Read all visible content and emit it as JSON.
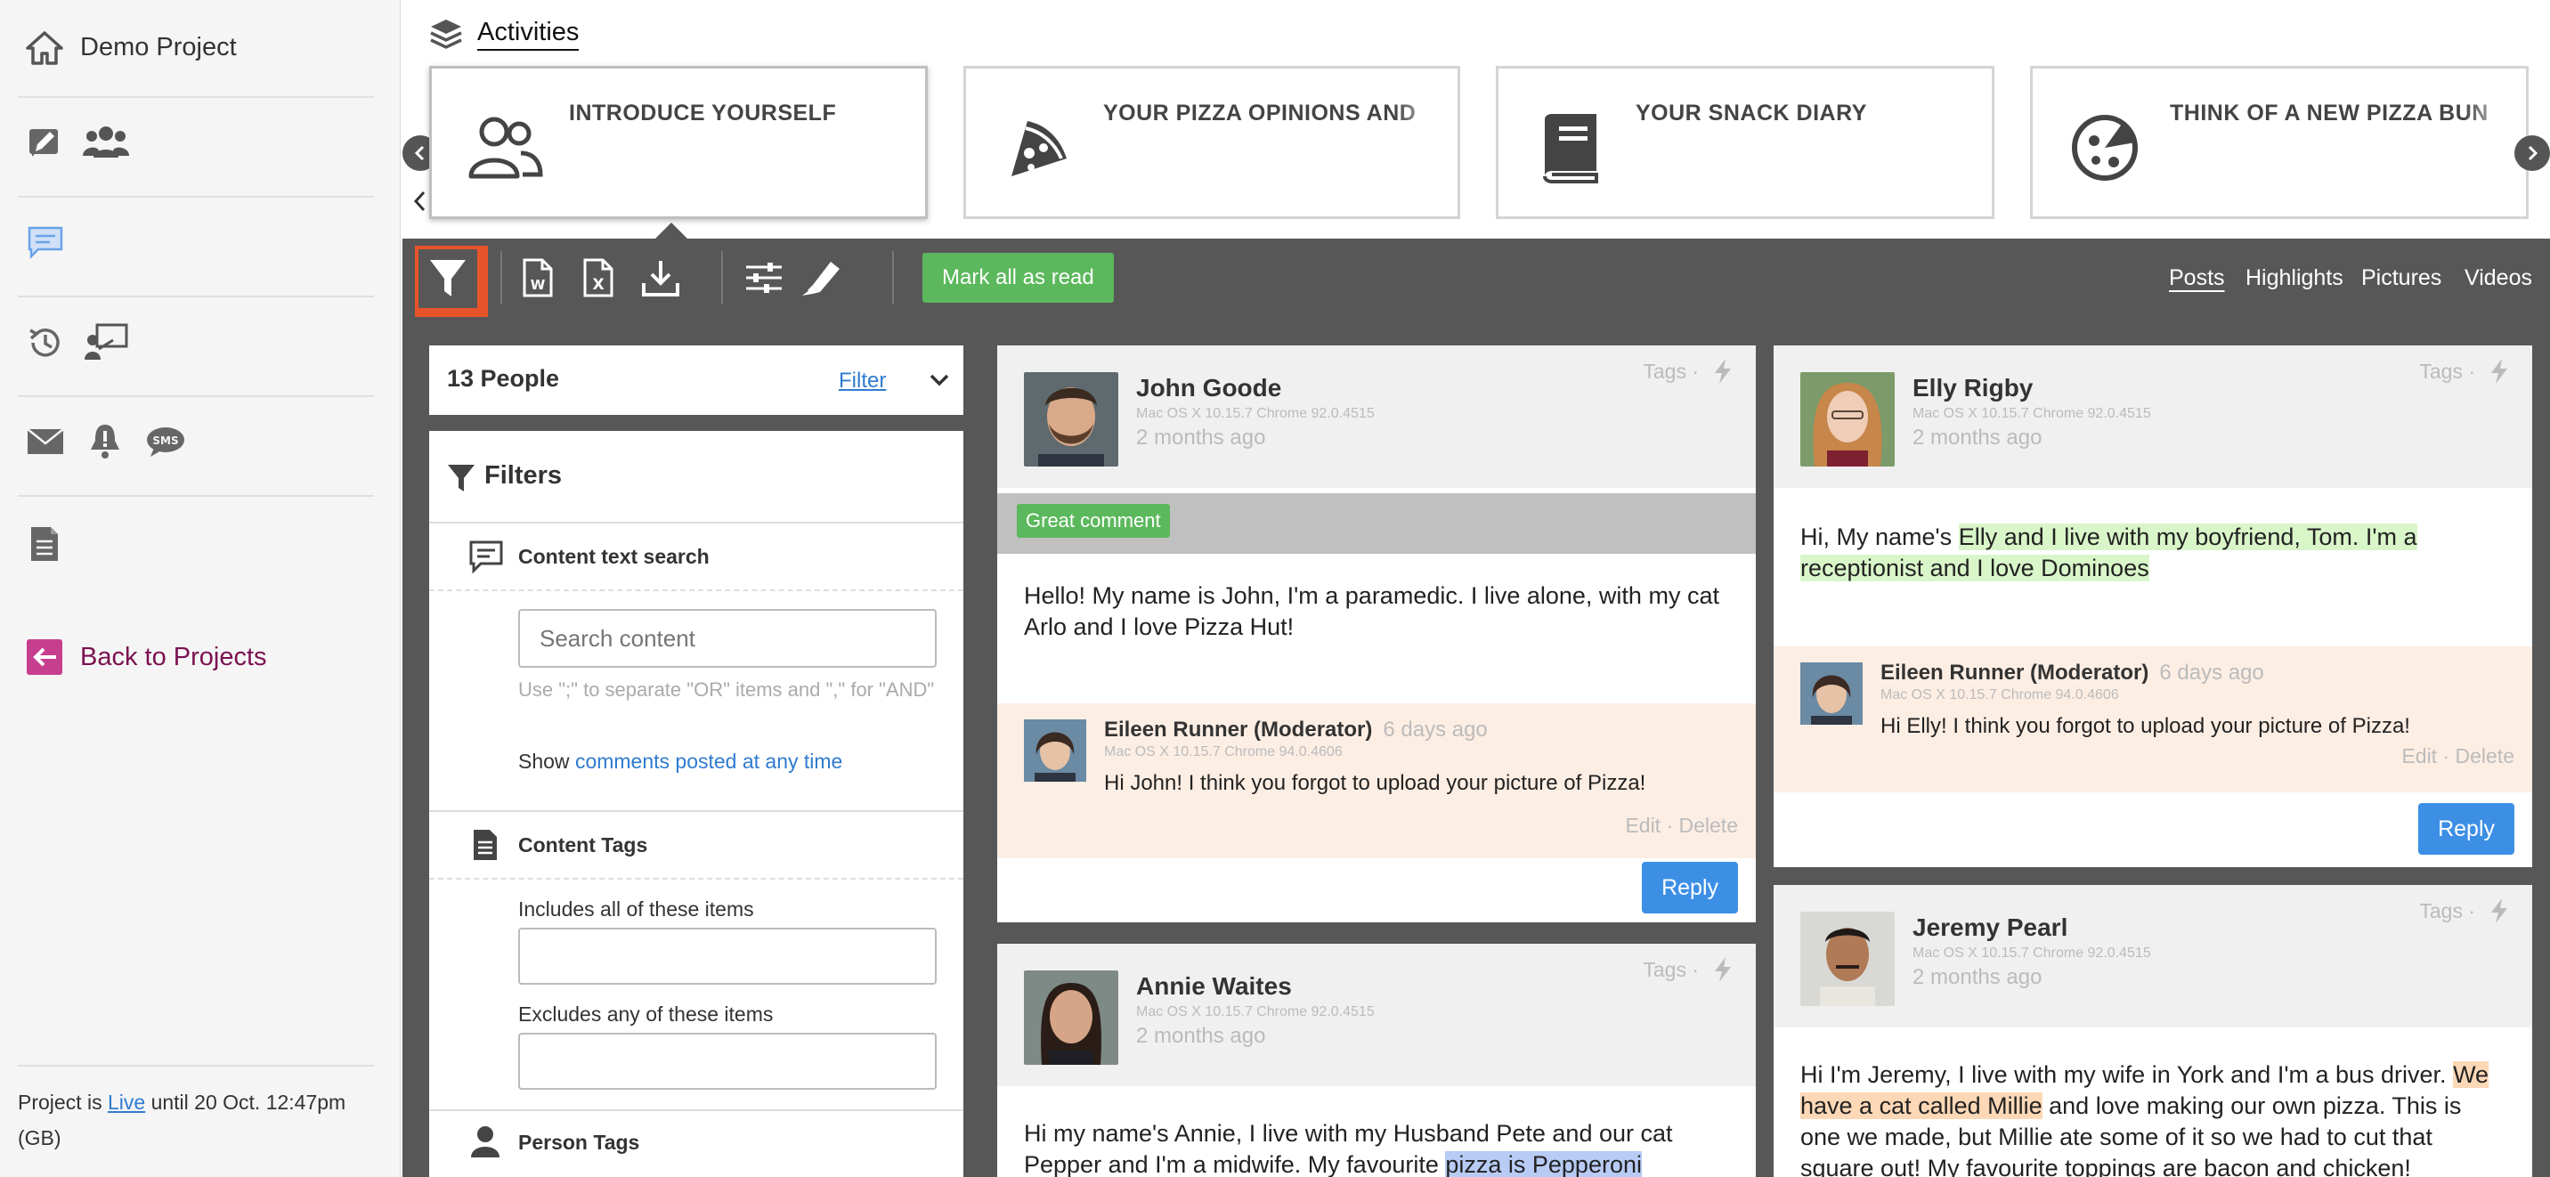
{
  "sidebar": {
    "project_title": "Demo Project",
    "back_label": "Back to Projects",
    "footer": {
      "prefix": "Project is ",
      "status": "Live",
      "suffix": " until 20 Oct. 12:47pm",
      "tz": "(GB)"
    },
    "accent_color": "#7a1150"
  },
  "activities": {
    "label": "Activities",
    "cards": [
      {
        "title": "INTRODUCE YOURSELF",
        "icon": "people-icon"
      },
      {
        "title": "YOUR PIZZA OPINIONS AND",
        "icon": "pizza-slice-icon"
      },
      {
        "title": "YOUR SNACK DIARY",
        "icon": "book-icon"
      },
      {
        "title": "THINK OF A NEW PIZZA BUN",
        "icon": "pizza-icon"
      }
    ]
  },
  "toolbar": {
    "mark_all_read": "Mark all as read",
    "views": [
      "Posts",
      "Highlights",
      "Pictures",
      "Videos"
    ],
    "active_view": "Posts"
  },
  "people": {
    "count_label": "13 People",
    "filter_label": "Filter"
  },
  "filters": {
    "title": "Filters",
    "content_search": {
      "title": "Content text search",
      "placeholder": "Search content",
      "hint": "Use \";\" to separate \"OR\" items and \",\" for \"AND\"",
      "show_prefix": "Show ",
      "show_link": "comments posted at any time"
    },
    "content_tags": {
      "title": "Content Tags",
      "includes_label": "Includes all of these items",
      "excludes_label": "Excludes any of these items"
    },
    "person_tags": {
      "title": "Person Tags"
    }
  },
  "posts": {
    "tags_label": "Tags ·",
    "reply_label": "Reply",
    "edit_delete": "Edit · Delete",
    "john": {
      "name": "John Goode",
      "device": "Mac OS X 10.15.7 Chrome 92.0.4515",
      "ago": "2 months ago",
      "tag": "Great comment",
      "body": "Hello! My name is John, I'm a paramedic. I live alone, with my cat Arlo and I love Pizza Hut!",
      "reply": {
        "name": "Eileen Runner (Moderator)",
        "ago": "6 days ago",
        "device": "Mac OS X 10.15.7 Chrome 94.0.4606",
        "text": "Hi John! I think you forgot to upload your picture of Pizza!"
      }
    },
    "annie": {
      "name": "Annie Waites",
      "device": "Mac OS X 10.15.7 Chrome 92.0.4515",
      "ago": "2 months ago",
      "body_a": "Hi my name's Annie, I live with my Husband Pete and our cat Pepper and I'm a midwife. My favourite ",
      "body_hl": "pizza is Pepperoni"
    },
    "elly": {
      "name": "Elly Rigby",
      "device": "Mac OS X 10.15.7 Chrome 92.0.4515",
      "ago": "2 months ago",
      "body_a": "Hi, My name's ",
      "body_hl": "Elly and I live with my boyfriend, Tom. I'm a receptionist and I love Dominoes",
      "reply": {
        "name": "Eileen Runner (Moderator)",
        "ago": "6 days ago",
        "device": "Mac OS X 10.15.7 Chrome 94.0.4606",
        "text": "Hi Elly! I think you forgot to upload your picture of Pizza!"
      }
    },
    "jeremy": {
      "name": "Jeremy Pearl",
      "device": "Mac OS X 10.15.7 Chrome 92.0.4515",
      "ago": "2 months ago",
      "body_a": "Hi I'm Jeremy, I live with my wife in York and I'm a bus driver. ",
      "body_hl": "We have a cat called Millie",
      "body_b": " and love making our own pizza. This is one we made, but Millie ate some of it so we had to cut that square out! My favourite toppings are bacon and chicken!"
    }
  },
  "colors": {
    "toolbar_bg": "#575757",
    "filter_active": "#e8542a",
    "mark_read": "#5cb85c",
    "reply_button": "#3d8fe6",
    "link": "#2f7bd0"
  }
}
